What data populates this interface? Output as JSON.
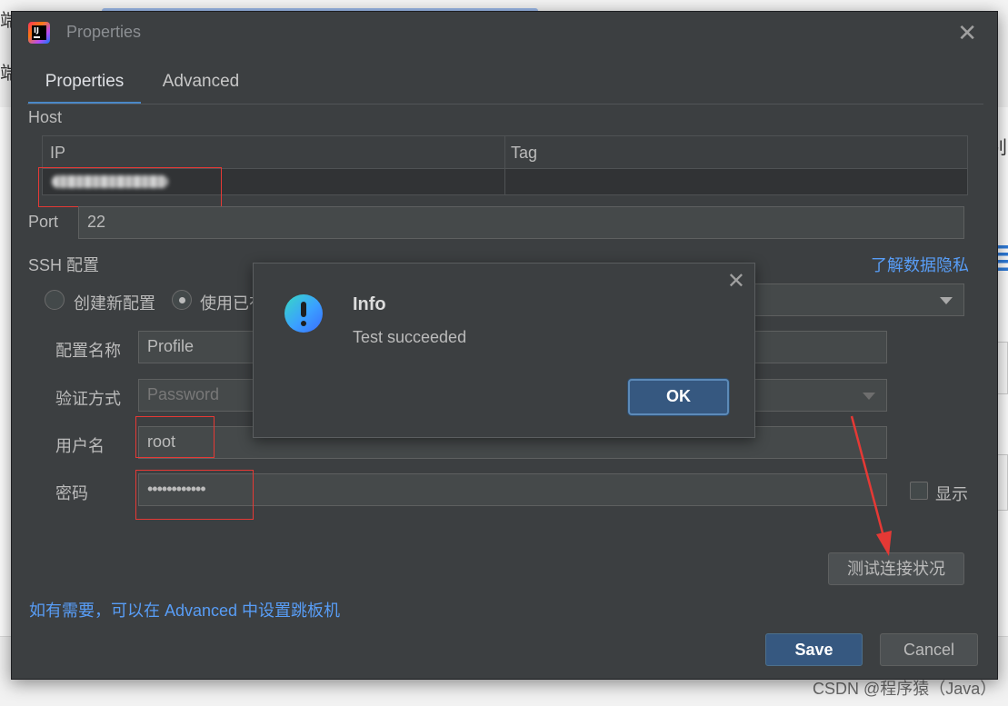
{
  "background": {
    "left_text_top": "端代码仓库",
    "left_text_bottom": "端",
    "right_text_a": "别",
    "right_text_b": "目",
    "watermark": "CSDN @程序猿（Java）"
  },
  "dialog": {
    "title": "Properties",
    "tabs": [
      {
        "label": "Properties",
        "active": true
      },
      {
        "label": "Advanced",
        "active": false
      }
    ],
    "host": {
      "label": "Host",
      "columns": [
        "IP",
        "Tag"
      ],
      "rows": [
        {
          "ip": "",
          "tag": ""
        }
      ]
    },
    "port": {
      "label": "Port",
      "value": "22"
    },
    "ssh": {
      "label": "SSH 配置",
      "privacy_link": "了解数据隐私",
      "radio_new": "创建新配置",
      "radio_existing": "使用已有",
      "profile_label": "配置名称",
      "profile_value": "Profile",
      "auth_label": "验证方式",
      "auth_value": "Password",
      "username_label": "用户名",
      "username_value": "root",
      "password_label": "密码",
      "password_value": "••••••••••••",
      "show_label": "显示",
      "test_button": "测试连接状况"
    },
    "advanced_hint": "如有需要，可以在 Advanced 中设置跳板机",
    "save_button": "Save",
    "cancel_button": "Cancel"
  },
  "popup": {
    "title": "Info",
    "message": "Test succeeded",
    "ok_button": "OK"
  },
  "colors": {
    "accent": "#4a88c7",
    "link": "#589df6",
    "primary_button": "#365880",
    "annotation_red": "#e53935"
  }
}
